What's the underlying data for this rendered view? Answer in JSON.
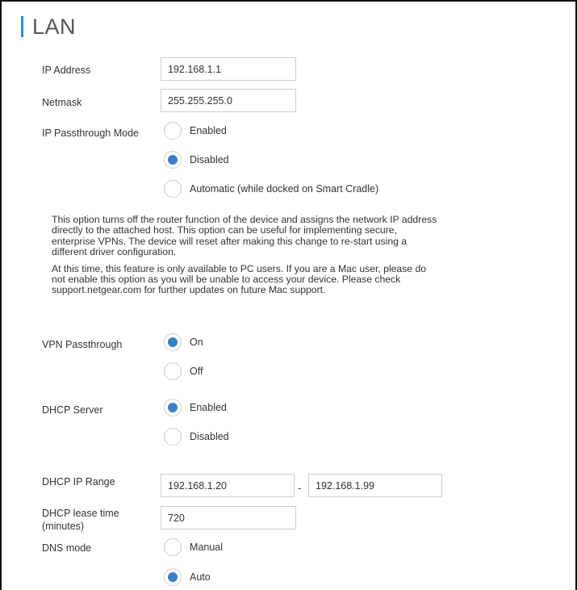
{
  "section": {
    "title": "LAN"
  },
  "ip_address": {
    "label": "IP Address",
    "value": "192.168.1.1"
  },
  "netmask": {
    "label": "Netmask",
    "value": "255.255.255.0"
  },
  "ip_passthrough": {
    "label": "IP Passthrough Mode",
    "options": [
      {
        "label": "Enabled",
        "selected": false
      },
      {
        "label": "Disabled",
        "selected": true
      },
      {
        "label": "Automatic (while docked on Smart Cradle)",
        "selected": false
      }
    ]
  },
  "info": {
    "paragraph1": "This option turns off the router function of the device and assigns the network IP address directly to the attached host. This option can be useful for implementing secure, enterprise VPNs. The device will reset after making this change to re-start using a different driver configuration.",
    "paragraph2_prefix": "At this time, this feature is only available to PC users. If you are a Mac user, please do not enable this option as you will be unable to access your device. Please check ",
    "link": "support.netgear.com",
    "paragraph2_suffix": " for further updates on future Mac support."
  },
  "vpn_passthrough": {
    "label": "VPN Passthrough",
    "options": [
      {
        "label": "On",
        "selected": true
      },
      {
        "label": "Off",
        "selected": false
      }
    ]
  },
  "dhcp_server": {
    "label": "DHCP Server",
    "options": [
      {
        "label": "Enabled",
        "selected": true
      },
      {
        "label": "Disabled",
        "selected": false
      }
    ]
  },
  "dhcp_range": {
    "label": "DHCP IP Range",
    "start": "192.168.1.20",
    "separator": "-",
    "end": "192.168.1.99"
  },
  "dhcp_lease": {
    "label_line1": "DHCP lease time",
    "label_line2": "(minutes)",
    "value": "720"
  },
  "dns_mode": {
    "label": "DNS mode",
    "options": [
      {
        "label": "Manual",
        "selected": false
      },
      {
        "label": "Auto",
        "selected": true
      }
    ]
  },
  "colors": {
    "accent": "#2a8fd8",
    "radio_selected": "#3a7fc6",
    "border": "#cfcfcf"
  }
}
